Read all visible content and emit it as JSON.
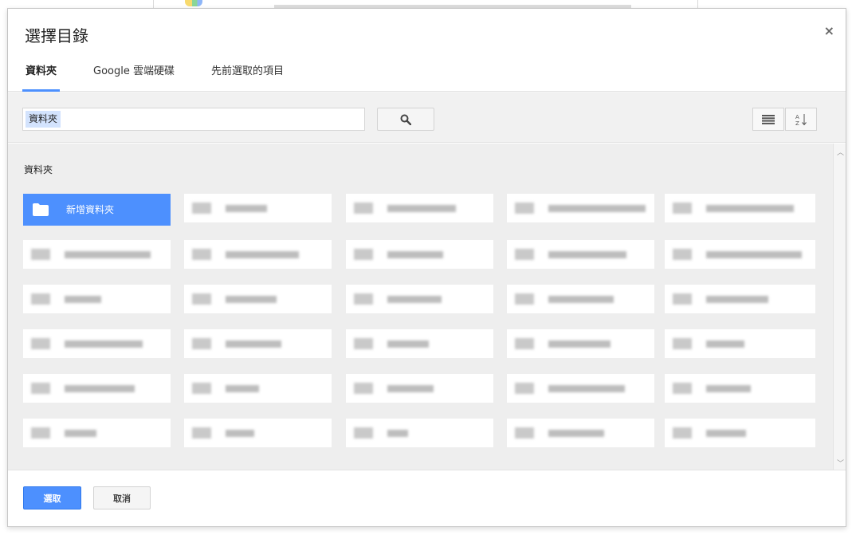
{
  "dialog": {
    "title": "選擇目錄",
    "close_glyph": "×"
  },
  "tabs": [
    {
      "label": "資料夾",
      "active": true
    },
    {
      "label": "Google 雲端硬碟",
      "active": false
    },
    {
      "label": "先前選取的項目",
      "active": false
    }
  ],
  "search": {
    "chip_value": "資料夾",
    "icon": "search-icon"
  },
  "view_controls": {
    "list_icon": "list-view-icon",
    "sort_icon": "sort-az-icon"
  },
  "content": {
    "section_label": "資料夾",
    "new_folder_label": "新增資料夾",
    "new_folder_icon": "folder-icon"
  },
  "footer": {
    "select_label": "選取",
    "cancel_label": "取消"
  },
  "colors": {
    "accent": "#4d90fe",
    "panel_bg": "#eeeeee"
  }
}
